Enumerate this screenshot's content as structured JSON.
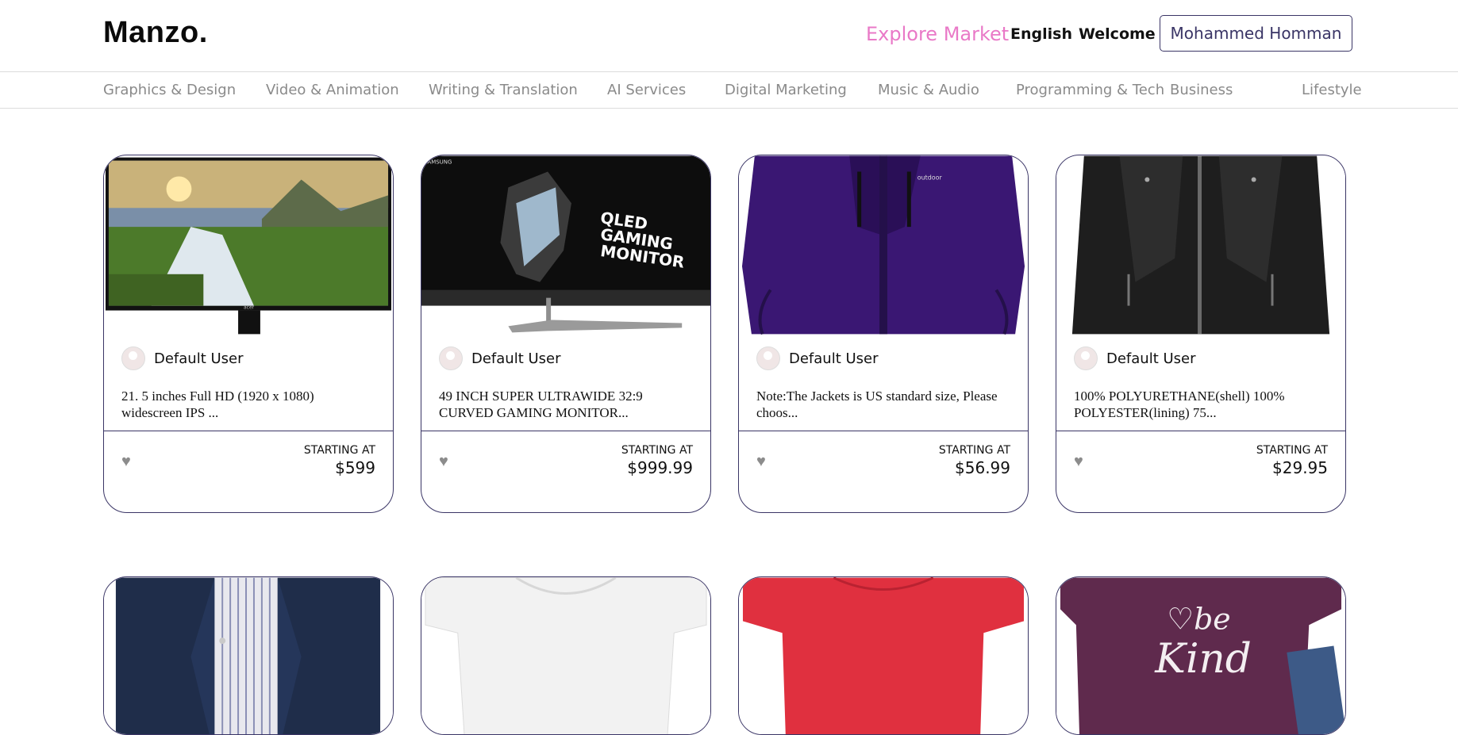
{
  "header": {
    "logo": "Manzo.",
    "explore": "Explore Market",
    "language": "English",
    "welcome": "Welcome",
    "user_name": "Mohammed Homman"
  },
  "categories": [
    "Graphics & Design",
    "Video & Animation",
    "Writing & Translation",
    "AI Services",
    "Digital Marketing",
    "Music & Audio",
    "Programming & Tech",
    "Business",
    "Lifestyle"
  ],
  "cards": [
    {
      "seller": "Default User",
      "desc": "21. 5 inches Full HD (1920 x 1080) widescreen IPS ...",
      "starting": "STARTING AT",
      "price": "$599"
    },
    {
      "seller": "Default User",
      "desc": "49 INCH SUPER ULTRAWIDE 32:9 CURVED GAMING MONITOR...",
      "starting": "STARTING AT",
      "price": "$999.99"
    },
    {
      "seller": "Default User",
      "desc": "Note:The Jackets is US standard size, Please choos...",
      "starting": "STARTING AT",
      "price": "$56.99"
    },
    {
      "seller": "Default User",
      "desc": "100% POLYURETHANE(shell) 100% POLYESTER(lining) 75...",
      "starting": "STARTING AT",
      "price": "$29.95"
    }
  ],
  "images": {
    "monitor_brand": "acer",
    "curved_brand": "SAMSUNG",
    "curved_line1": "QLED",
    "curved_line2": "GAMING",
    "curved_line3": "MONITOR",
    "jacket_brand": "outdoor",
    "tshirt_line1": "♡be",
    "tshirt_line2": "Kind"
  },
  "colors": {
    "accent_pink": "#e979c7",
    "card_border": "#3a3566",
    "category_text": "#8a8a8a"
  }
}
